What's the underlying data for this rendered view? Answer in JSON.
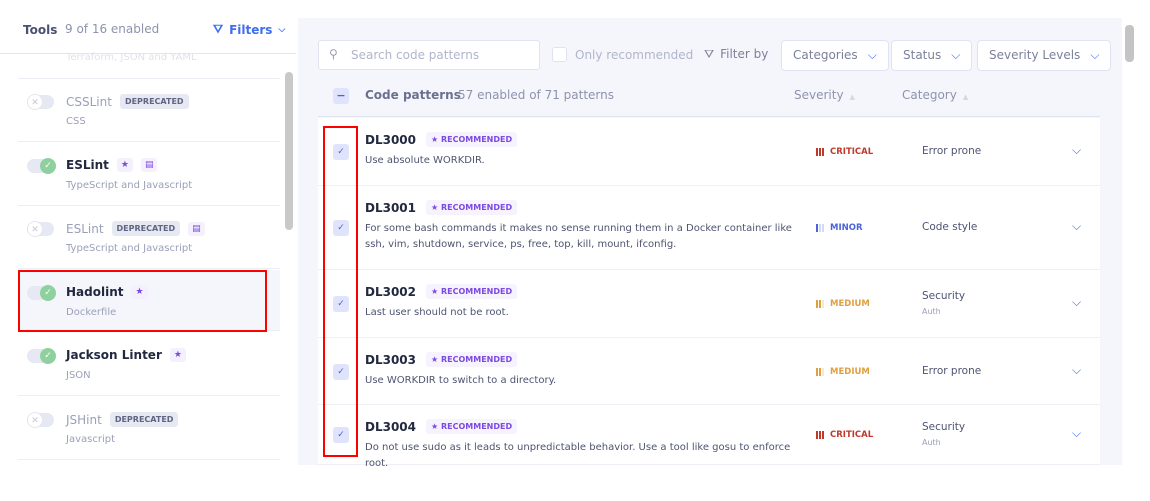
{
  "tools": {
    "title": "Tools",
    "count": "9 of 16 enabled",
    "filters": "Filters",
    "partial_subtitle": "Terraform, JSON and YAML",
    "items": [
      {
        "name": "CSSLint",
        "subtitle": "CSS",
        "enabled": false,
        "deprecated": "DEPRECATED",
        "star": false,
        "doc": false
      },
      {
        "name": "ESLint",
        "subtitle": "TypeScript and Javascript",
        "enabled": true,
        "star": true,
        "doc": true
      },
      {
        "name": "ESLint",
        "subtitle": "TypeScript and Javascript",
        "enabled": false,
        "deprecated": "DEPRECATED",
        "star": false,
        "doc": true
      },
      {
        "name": "Hadolint",
        "subtitle": "Dockerfile",
        "enabled": true,
        "star": true,
        "doc": false,
        "selected": true
      },
      {
        "name": "Jackson Linter",
        "subtitle": "JSON",
        "enabled": true,
        "star": true,
        "doc": false
      },
      {
        "name": "JSHint",
        "subtitle": "Javascript",
        "enabled": false,
        "deprecated": "DEPRECATED",
        "star": false,
        "doc": false
      }
    ]
  },
  "patterns": {
    "search_placeholder": "Search code patterns",
    "only_recommended": "Only recommended",
    "filter_by": "Filter by",
    "dropdowns": [
      "Categories",
      "Status",
      "Severity Levels"
    ],
    "header": {
      "title": "Code patterns",
      "count": "57 enabled of 71 patterns",
      "severity": "Severity",
      "category": "Category"
    },
    "rows": [
      {
        "id": "DL3000",
        "badge": "RECOMMENDED",
        "desc": "Use absolute WORKDIR.",
        "severity": "CRITICAL",
        "level": 3,
        "category": "Error prone",
        "checked": true
      },
      {
        "id": "DL3001",
        "badge": "RECOMMENDED",
        "desc": "For some bash commands it makes no sense running them in a Docker container like ssh, vim, shutdown, service, ps, free, top, kill, mount, ifconfig.",
        "severity": "MINOR",
        "level": 1,
        "category": "Code style",
        "checked": true
      },
      {
        "id": "DL3002",
        "badge": "RECOMMENDED",
        "desc": "Last user should not be root.",
        "severity": "MEDIUM",
        "level": 2,
        "category": "Security",
        "subcategory": "Auth",
        "checked": true
      },
      {
        "id": "DL3003",
        "badge": "RECOMMENDED",
        "desc": "Use WORKDIR to switch to a directory.",
        "severity": "MEDIUM",
        "level": 2,
        "category": "Error prone",
        "checked": true
      },
      {
        "id": "DL3004",
        "badge": "RECOMMENDED",
        "desc": "Do not use sudo as it leads to unpredictable behavior. Use a tool like gosu to enforce root.",
        "severity": "CRITICAL",
        "level": 3,
        "category": "Security",
        "subcategory": "Auth",
        "checked": true
      }
    ]
  },
  "colors": {
    "accent": "#3e6ff0",
    "critical": "#c0392b",
    "medium": "#e0a040",
    "minor": "#4a63d8",
    "recommended": "#7b4ae0"
  }
}
